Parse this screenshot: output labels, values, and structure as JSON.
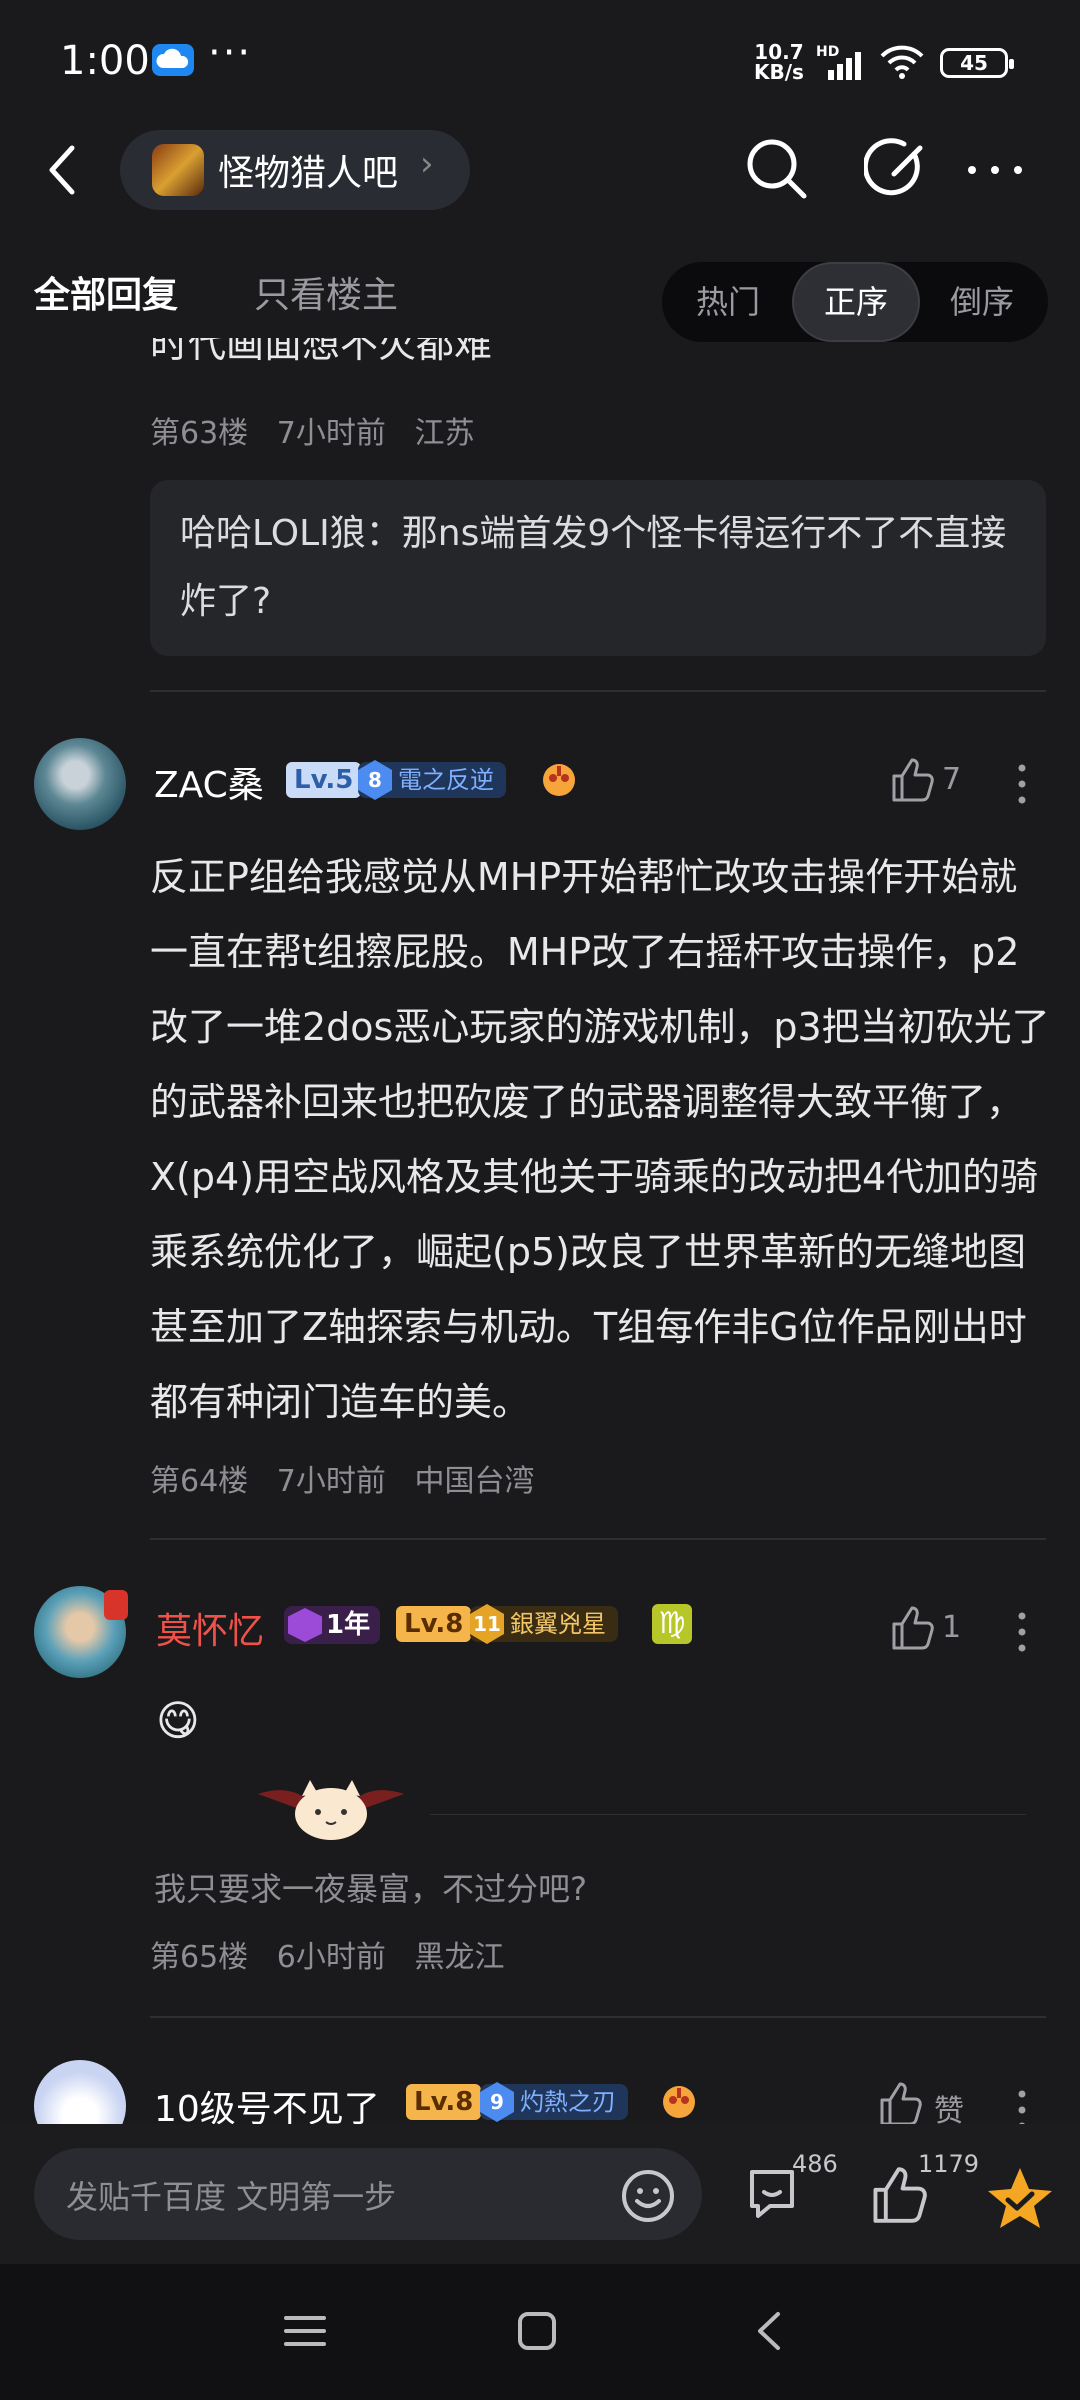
{
  "status": {
    "time": "1:00",
    "dots": "···",
    "net_speed": "10.7",
    "net_unit": "KB/s",
    "hd": "HD",
    "battery": "45"
  },
  "header": {
    "forum_name": "怪物猎人吧",
    "chevron": "›"
  },
  "filters": {
    "all_replies": "全部回复",
    "owner_only": "只看楼主",
    "sort_hot": "热门",
    "sort_asc": "正序",
    "sort_desc": "倒序"
  },
  "prev_post": {
    "clipped_text": "时代画面想不火都难",
    "floor": "第63楼",
    "time": "7小时前",
    "location": "江苏",
    "reply_author": "哈哈LOLI狼：",
    "reply_text": "那ns端首发9个怪卡得运行不了不直接炸了?"
  },
  "post64": {
    "username": "ZAC桑",
    "level": "Lv.5",
    "medal_num": "8",
    "medal_name": "電之反逆",
    "likes": "7",
    "body": "反正P组给我感觉从MHP开始帮忙改攻击操作开始就一直在帮t组擦屁股。MHP改了右摇杆攻击操作，p2改了一堆2dos恶心玩家的游戏机制，p3把当初砍光了的武器补回来也把砍废了的武器调整得大致平衡了，X(p4)用空战风格及其他关于骑乘的改动把4代加的骑乘系统优化了，崛起(p5)改良了世界革新的无缝地图甚至加了Z轴探索与机动。T组每作非G位作品刚出时都有种闭门造车的美。",
    "floor": "第64楼",
    "time": "7小时前",
    "location": "中国台湾"
  },
  "post65": {
    "username": "莫怀忆",
    "year_badge": "1年",
    "level": "Lv.8",
    "medal_num": "11",
    "medal_name": "銀翼兇星",
    "zodiac": "♍",
    "likes": "1",
    "emoji": "😋",
    "signature": "我只要求一夜暴富，不过分吧?",
    "floor": "第65楼",
    "time": "6小时前",
    "location": "黑龙江"
  },
  "post66": {
    "username": "10级号不见了",
    "level": "Lv.8",
    "medal_num": "9",
    "medal_name": "灼熱之刃",
    "like_label": "赞"
  },
  "bottom": {
    "placeholder": "发贴千百度 文明第一步",
    "comment_count": "486",
    "like_count": "1179"
  },
  "colors": {
    "background": "#1a1a1c",
    "username_red": "#f0524a",
    "accent_orange": "#f6b54a",
    "star": "#f5a623"
  }
}
